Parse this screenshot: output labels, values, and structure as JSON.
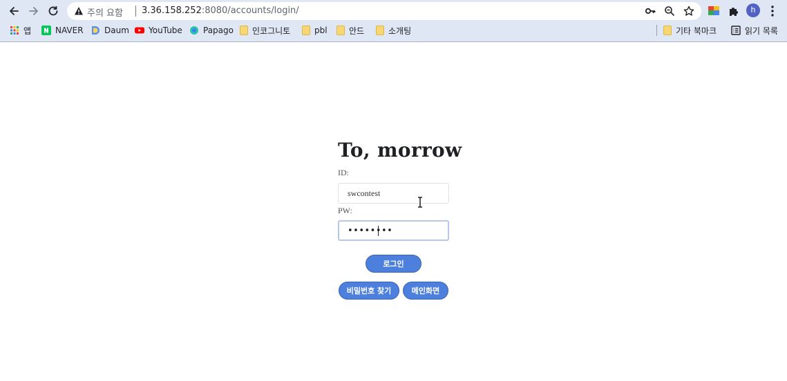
{
  "browser": {
    "omnibox": {
      "security_label": "주의 요함",
      "url_host": "3.36.158.252",
      "url_rest": ":8080/accounts/login/"
    },
    "profile_initial": "h",
    "bookmarks": [
      {
        "label": "앱",
        "icon": "apps-grid-icon"
      },
      {
        "label": "NAVER",
        "icon": "naver-icon"
      },
      {
        "label": "Daum",
        "icon": "daum-icon"
      },
      {
        "label": "YouTube",
        "icon": "youtube-icon"
      },
      {
        "label": "Papago",
        "icon": "papago-icon"
      },
      {
        "label": "인코그니토",
        "icon": "folder-icon"
      },
      {
        "label": "pbl",
        "icon": "folder-icon"
      },
      {
        "label": "안드",
        "icon": "folder-icon"
      },
      {
        "label": "소개팅",
        "icon": "folder-icon"
      }
    ],
    "other_bookmarks": "기타 북마크",
    "reading_list": "읽기 목록"
  },
  "login": {
    "title": "To, morrow",
    "id_label": "ID:",
    "id_value": "swcontest",
    "pw_label": "PW:",
    "pw_masked": "••••••••",
    "login_button": "로그인",
    "find_password_button": "비밀번호 찾기",
    "main_page_button": "메인화면"
  },
  "colors": {
    "chrome_bg": "#dfe7f5",
    "button_bg": "#4d7fdc",
    "button_border": "#3a63b5",
    "focus_ring": "#b6c8ea"
  }
}
